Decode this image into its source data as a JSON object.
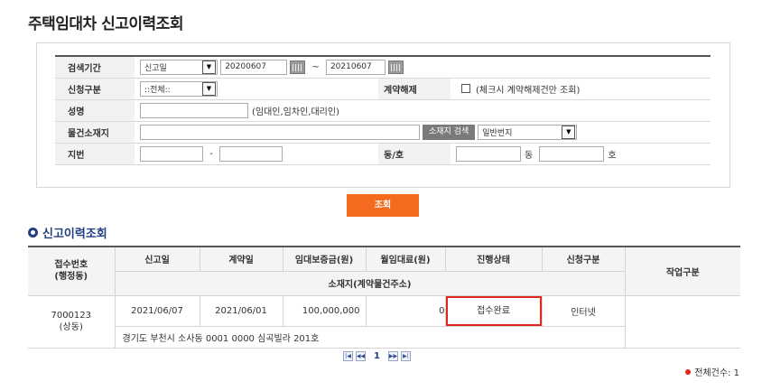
{
  "page_title": "주택임대차 신고이력조회",
  "search": {
    "period_label": "검색기간",
    "period_type": "신고일",
    "date_from": "20200607",
    "tilde": "~",
    "date_to": "20210607",
    "request_type_label": "신청구분",
    "request_type_value": "::전체::",
    "cancel_label": "계약해제",
    "cancel_hint": "(체크시 계약해제건만 조회)",
    "name_label": "성명",
    "name_value": "",
    "name_hint": "(임대인,임차인,대리인)",
    "location_label": "물건소재지",
    "location_value": "",
    "location_search_label": "소재지 검색",
    "address_type": "일반번지",
    "lot_label": "지번",
    "lot_main": "",
    "lot_dash": "-",
    "lot_sub": "",
    "dongho_label": "동/호",
    "dong_value": "",
    "dong_unit": "동",
    "ho_value": "",
    "ho_unit": "호"
  },
  "search_button": "조회",
  "section_title": "신고이력조회",
  "table": {
    "headers": {
      "receipt_no": "접수번호\n(행정동)",
      "report_date": "신고일",
      "contract_date": "계약일",
      "deposit": "임대보증금(원)",
      "monthly_rent": "월임대료(원)",
      "progress": "진행상태",
      "request_type": "신청구분",
      "work_type": "작업구분",
      "address": "소재지(계약물건주소)"
    },
    "rows": [
      {
        "receipt_no": "7000123",
        "dong": "(상동)",
        "report_date": "2021/06/07",
        "contract_date": "2021/06/01",
        "deposit": "100,000,000",
        "monthly_rent": "0",
        "progress": "접수완료",
        "request_type": "인터넷",
        "work_type": "",
        "address": "경기도 부천시 소사동 0001 0000 심곡빌라 201호"
      }
    ]
  },
  "pagination": {
    "current_page": "1"
  },
  "total_count": "전체건수: 1",
  "colors": {
    "accent": "#f46a1e",
    "section_title": "#1f3f7f",
    "highlight_border": "#e1261c"
  }
}
